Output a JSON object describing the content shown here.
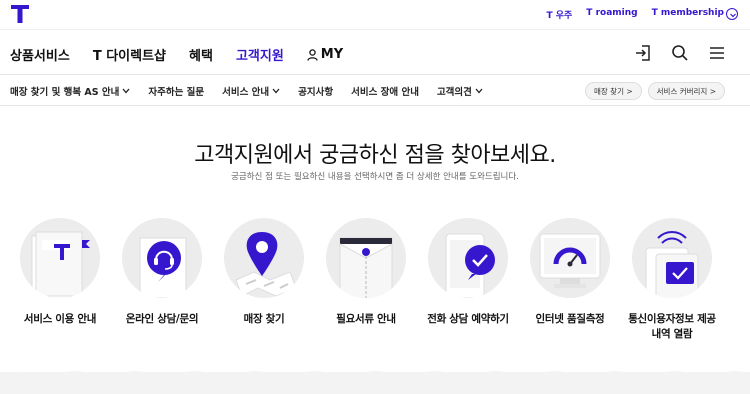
{
  "util": {
    "logo_letter": "T",
    "links": [
      "T 우주",
      "T roaming",
      "T membership"
    ]
  },
  "gnb": {
    "items": [
      "상품서비스",
      "T 다이렉트샵",
      "혜택",
      "고객지원",
      "MY"
    ],
    "active_index": 3
  },
  "lnb": {
    "items": [
      "매장 찾기 및 행복 AS 안내",
      "자주하는 질문",
      "서비스 안내",
      "공지사항",
      "서비스 장애 안내",
      "고객의견"
    ],
    "buttons": [
      "매장 찾기 >",
      "서비스 커버리지 >"
    ]
  },
  "hero": {
    "title": "고객지원에서 궁금하신 점을 찾아보세요.",
    "subtitle": "궁금하신 점 또는 필요하신 내용을 선택하시면 좀 더 상세한 안내를 도와드립니다."
  },
  "services": [
    {
      "label": "서비스 이용 안내",
      "icon": "service-guide-icon"
    },
    {
      "label": "온라인 상담/문의",
      "icon": "online-consult-icon"
    },
    {
      "label": "매장 찾기",
      "icon": "map-pin-icon"
    },
    {
      "label": "필요서류 안내",
      "icon": "document-envelope-icon"
    },
    {
      "label": "전화 상담 예약하기",
      "icon": "phone-reservation-icon"
    },
    {
      "label": "인터넷 품질측정",
      "icon": "speed-test-icon"
    },
    {
      "label": "통신이용자정보 제공 내역 열람",
      "icon": "data-history-icon"
    }
  ],
  "colors": {
    "brand": "#3617ce",
    "circle_bg": "#ececec"
  }
}
